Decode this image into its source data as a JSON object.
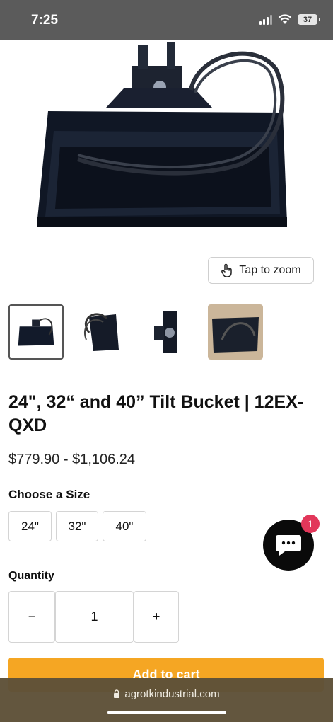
{
  "status": {
    "time": "7:25",
    "battery": "37"
  },
  "gallery": {
    "zoom_label": "Tap to zoom",
    "thumbnails": [
      "bucket-front",
      "bucket-side-hoses",
      "bucket-mount",
      "bucket-photo"
    ]
  },
  "product": {
    "title": "24\", 32“ and 40” Tilt Bucket | 12EX-QXD",
    "price_range": "$779.90 - $1,106.24",
    "size_label": "Choose a Size",
    "sizes": [
      "24\"",
      "32\"",
      "40\""
    ],
    "quantity_label": "Quantity",
    "quantity": "1",
    "decrement": "−",
    "increment": "+",
    "add_to_cart": "Add to cart"
  },
  "chat": {
    "badge": "1"
  },
  "browser": {
    "url": "agrotkindustrial.com"
  },
  "colors": {
    "cart_button": "#f5a623",
    "badge": "#e2375a",
    "browser_bar": "#5e5138"
  }
}
